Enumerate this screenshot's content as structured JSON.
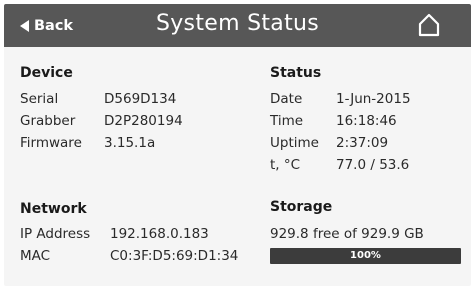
{
  "header": {
    "back_label": "Back",
    "title": "System Status",
    "home_icon": "home-icon",
    "back_icon": "triangle-left-icon"
  },
  "device": {
    "title": "Device",
    "rows": [
      {
        "label": "Serial",
        "value": "D569D134"
      },
      {
        "label": "Grabber",
        "value": "D2P280194"
      },
      {
        "label": "Firmware",
        "value": "3.15.1a"
      }
    ]
  },
  "status": {
    "title": "Status",
    "rows": [
      {
        "label": "Date",
        "value": "1-Jun-2015"
      },
      {
        "label": "Time",
        "value": "16:18:46"
      },
      {
        "label": "Uptime",
        "value": "2:37:09"
      },
      {
        "label": "t, °C",
        "value": "77.0 / 53.6"
      }
    ]
  },
  "network": {
    "title": "Network",
    "rows": [
      {
        "label": "IP Address",
        "value": "192.168.0.183"
      },
      {
        "label": "MAC",
        "value": "C0:3F:D5:69:D1:34"
      }
    ]
  },
  "storage": {
    "title": "Storage",
    "summary": "929.8 free of 929.9 GB",
    "percent_label": "100%",
    "fill_percent": 100
  },
  "colors": {
    "titlebar": "#575757",
    "background": "#f5f5f5",
    "bar": "#3c3c3c"
  }
}
